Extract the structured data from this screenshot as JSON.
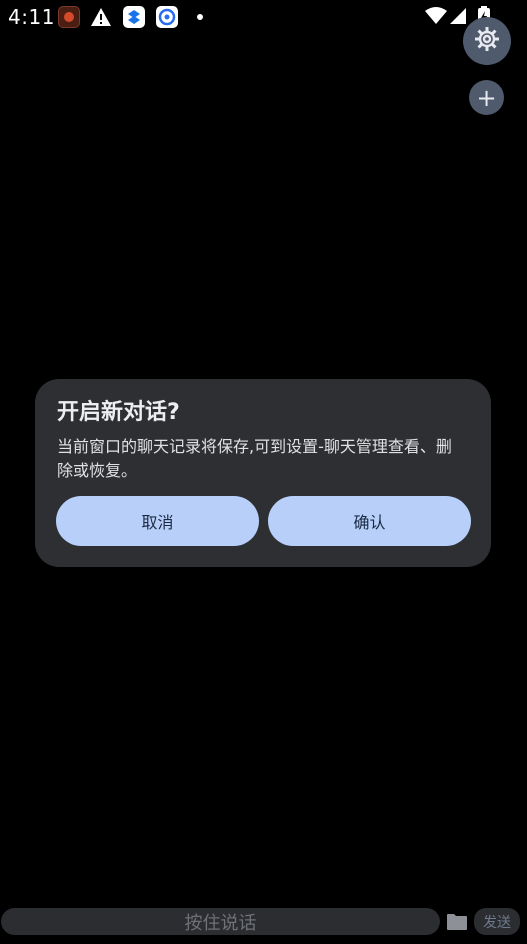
{
  "status_bar": {
    "time": "4:11",
    "icons": [
      "app-notification-icon",
      "warning-icon",
      "dropbox-app-icon",
      "messenger-app-icon",
      "notification-dot-icon",
      "wifi-icon",
      "signal-icon",
      "battery-charging-icon"
    ]
  },
  "fabs": {
    "settings_icon": "gear-icon",
    "add_label": "+"
  },
  "dialog": {
    "title": "开启新对话?",
    "message": "当前窗口的聊天记录将保存,可到设置-聊天管理查看、删除或恢复。",
    "cancel_label": "取消",
    "confirm_label": "确认"
  },
  "bottom_bar": {
    "voice_label": "按住说话",
    "folder_icon": "folder-icon",
    "send_label": "发送"
  },
  "colors": {
    "background": "#000000",
    "dialog_bg": "#2e2f33",
    "button_bg": "#b8d0f9",
    "fab_bg": "#4f5a6c"
  }
}
